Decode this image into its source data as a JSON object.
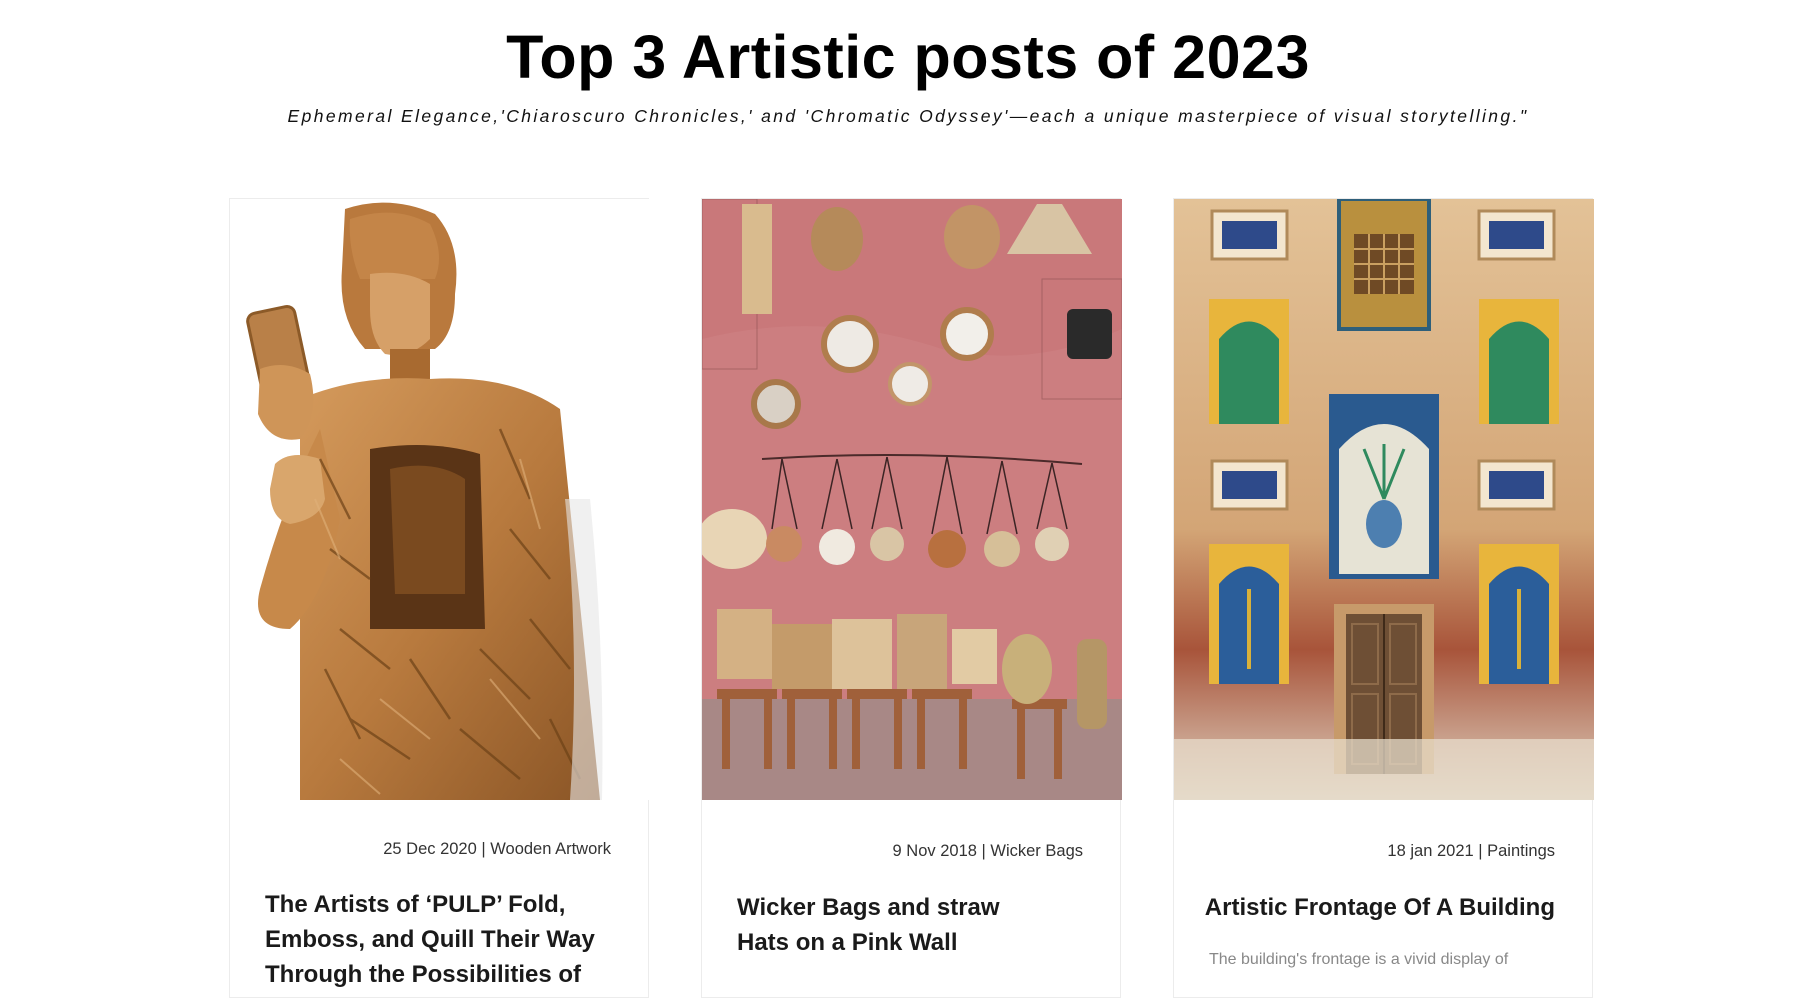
{
  "header": {
    "title": "Top 3 Artistic posts of 2023",
    "subtitle": "Ephemeral Elegance,'Chiaroscuro Chronicles,' and 'Chromatic Odyssey'—each a unique masterpiece of visual storytelling.\""
  },
  "posts": [
    {
      "meta": "25 Dec 2020 | Wooden Artwork",
      "title": "The Artists of ‘PULP’ Fold, Emboss, and Quill Their Way Through the Possibilities of",
      "image_subject": "wooden-sculpture-person-holding-phone"
    },
    {
      "meta": "9 Nov 2018 | Wicker Bags",
      "title": "Wicker Bags and straw Hats on a Pink Wall",
      "image_subject": "wicker-bags-straw-hats-pink-wall"
    },
    {
      "meta": "18 jan 2021 | Paintings",
      "title": "Artistic Frontage Of A Building",
      "excerpt": "The building's frontage is a vivid display of",
      "image_subject": "tiled-building-frontage-with-door"
    }
  ],
  "colors": {
    "card_border": "#ececec",
    "meta_text": "#333333",
    "excerpt_text": "#888888"
  }
}
